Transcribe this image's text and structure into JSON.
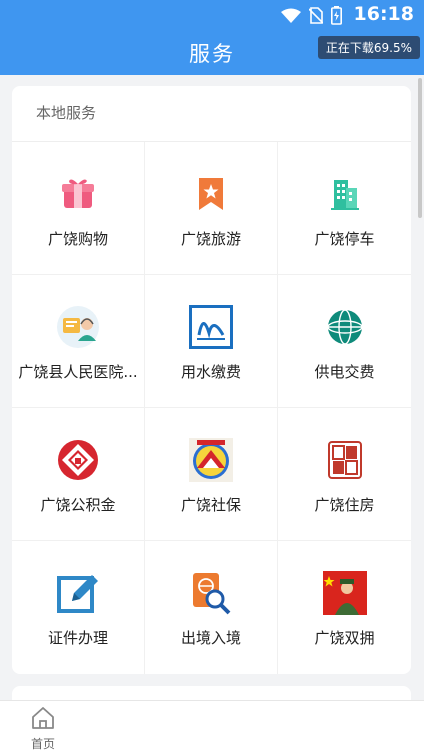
{
  "status_bar": {
    "time": "16:18",
    "icons": [
      "wifi-icon",
      "no-sim-icon",
      "battery-charging-icon"
    ]
  },
  "header": {
    "title": "服务",
    "download_status": "正在下载69.5%",
    "download_progress_percent": 69.5
  },
  "local_services": {
    "title": "本地服务",
    "items": [
      {
        "label": "广饶购物",
        "icon": "shopping-gift-icon"
      },
      {
        "label": "广饶旅游",
        "icon": "travel-bookmark-icon"
      },
      {
        "label": "广饶停车",
        "icon": "parking-building-icon"
      },
      {
        "label": "广饶县人民医院...",
        "icon": "hospital-consult-icon"
      },
      {
        "label": "用水缴费",
        "icon": "water-payment-icon"
      },
      {
        "label": "供电交费",
        "icon": "state-grid-icon"
      },
      {
        "label": "广饶公积金",
        "icon": "housing-fund-icon"
      },
      {
        "label": "广饶社保",
        "icon": "social-security-icon"
      },
      {
        "label": "广饶住房",
        "icon": "housing-seal-icon"
      },
      {
        "label": "证件办理",
        "icon": "certificate-edit-icon"
      },
      {
        "label": "出境入境",
        "icon": "passport-search-icon"
      },
      {
        "label": "广饶双拥",
        "icon": "military-support-icon"
      }
    ]
  },
  "bottom_nav": {
    "home_label": "首页"
  },
  "colors": {
    "header_blue": "#3f96f0",
    "background": "#f2f3f5"
  }
}
